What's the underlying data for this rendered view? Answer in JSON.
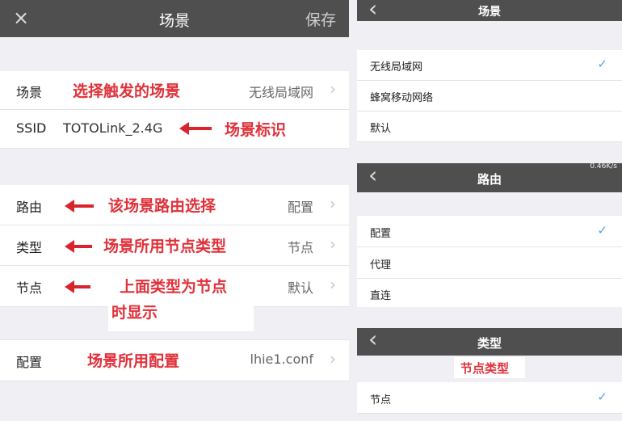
{
  "left_panel": {
    "header": {
      "close_icon": "×",
      "title": "场景",
      "save_label": "保存"
    },
    "rows": [
      {
        "label": "场景",
        "value": "无线局域网",
        "annotation": "选择触发的场景"
      },
      {
        "label": "SSID",
        "value": "TOTOLink_2.4G",
        "annotation": "场景标识"
      },
      {
        "label": "路由",
        "value": "配置",
        "annotation": "该场景路由选择"
      },
      {
        "label": "类型",
        "value": "节点",
        "annotation": "场景所用节点类型"
      },
      {
        "label": "节点",
        "value": "默认",
        "annotation_line1": "上面类型为节点",
        "annotation_line2": "时显示"
      },
      {
        "label": "配置",
        "value": "lhie1.conf",
        "annotation": "场景所用配置"
      }
    ]
  },
  "right_panels": {
    "scene": {
      "back_icon": "‹",
      "title": "场景",
      "options": [
        "无线局域网",
        "蜂窝移动网络",
        "默认"
      ],
      "selected": 0
    },
    "route": {
      "back_icon": "‹",
      "title": "路由",
      "speed": "0.46K/s",
      "options": [
        "配置",
        "代理",
        "直连"
      ],
      "selected": 0
    },
    "type": {
      "back_icon": "‹",
      "title": "类型",
      "annotation": "节点类型",
      "options": [
        "节点"
      ],
      "selected": 0
    }
  },
  "colors": {
    "navbar": "#4f4f4f",
    "annotation": "#e0313a",
    "check": "#5aa0e6",
    "background": "#efeff4"
  }
}
